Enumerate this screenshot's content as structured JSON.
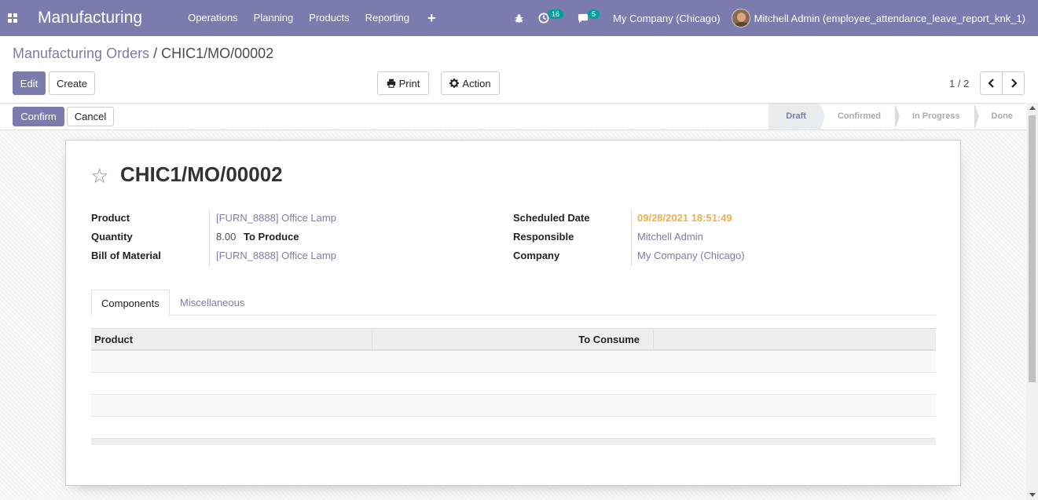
{
  "navbar": {
    "brand": "Manufacturing",
    "menu": [
      "Operations",
      "Planning",
      "Products",
      "Reporting"
    ],
    "add_icon": "+",
    "activity_count": "16",
    "message_count": "5",
    "company": "My Company (Chicago)",
    "user": "Mitchell Admin (employee_attendance_leave_report_knk_1)"
  },
  "breadcrumb": {
    "parent": "Manufacturing Orders",
    "separator": "/",
    "current": "CHIC1/MO/00002"
  },
  "buttons": {
    "edit": "Edit",
    "create": "Create",
    "print": "Print",
    "action": "Action",
    "confirm": "Confirm",
    "cancel": "Cancel"
  },
  "pager": {
    "value": "1 / 2"
  },
  "stages": [
    "Draft",
    "Confirmed",
    "In Progress",
    "Done"
  ],
  "active_stage": "Draft",
  "record": {
    "name": "CHIC1/MO/00002",
    "left_fields": [
      {
        "label": "Product",
        "value": "[FURN_8888] Office Lamp"
      },
      {
        "label": "Quantity",
        "value": "8.00",
        "suffix": "To Produce"
      },
      {
        "label": "Bill of Material",
        "value": "[FURN_8888] Office Lamp"
      }
    ],
    "right_fields": [
      {
        "label": "Scheduled Date",
        "value": "09/28/2021 18:51:49"
      },
      {
        "label": "Responsible",
        "value": "Mitchell Admin"
      },
      {
        "label": "Company",
        "value": "My Company (Chicago)"
      }
    ]
  },
  "tabs": [
    "Components",
    "Miscellaneous"
  ],
  "table": {
    "headers": [
      "Product",
      "To Consume"
    ]
  },
  "colors": {
    "brand": "#7c7bad",
    "scheduled_date": "#f0ad4e"
  },
  "icons": {
    "apps": "apps-grid-icon",
    "bug": "bug-icon",
    "activity": "clock-icon",
    "messages": "chat-icon",
    "print": "print-icon",
    "action": "gear-icon",
    "favorite": "star-icon"
  }
}
